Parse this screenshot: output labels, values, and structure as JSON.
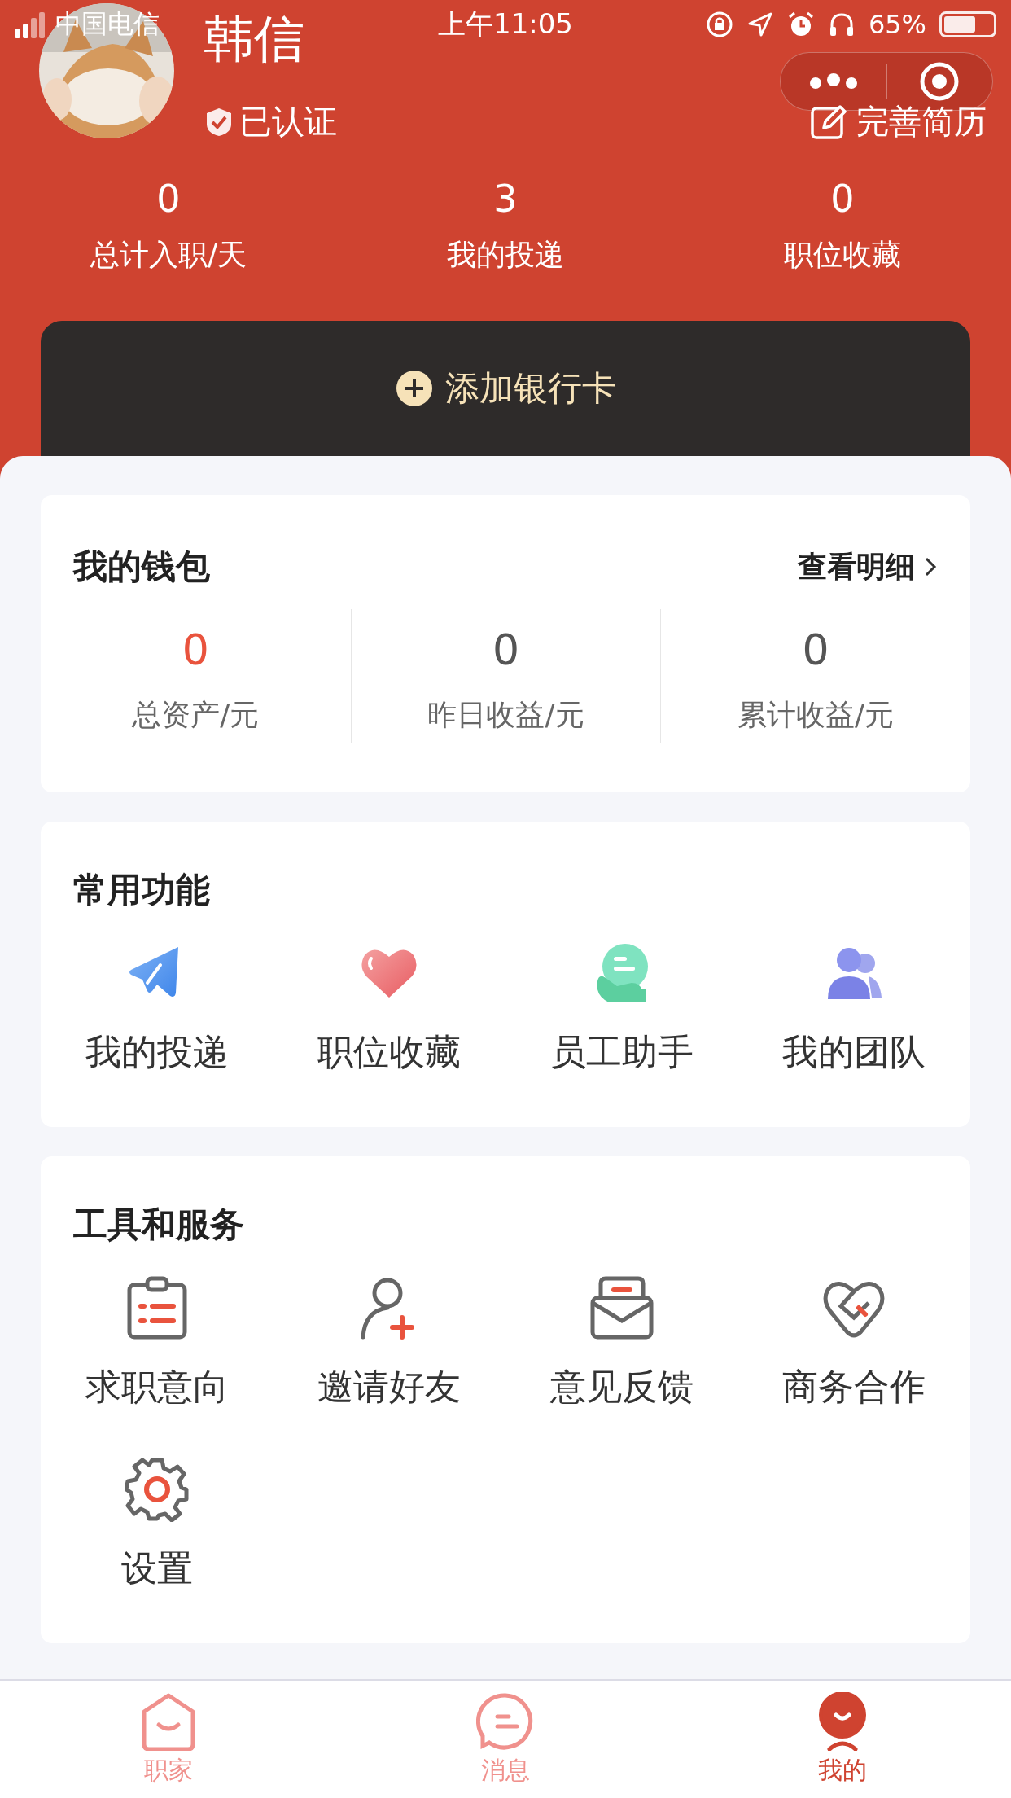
{
  "status_bar": {
    "carrier": "中国电信",
    "time": "上午11:05",
    "battery": "65%"
  },
  "profile": {
    "name": "韩信",
    "badge": "已认证",
    "edit_button": "完善简历"
  },
  "stats": [
    {
      "value": "0",
      "label": "总计入职/天"
    },
    {
      "value": "3",
      "label": "我的投递"
    },
    {
      "value": "0",
      "label": "职位收藏"
    }
  ],
  "bank_card_button": "添加银行卡",
  "wallet": {
    "title": "我的钱包",
    "detail_link": "查看明细",
    "items": [
      {
        "value": "0",
        "label": "总资产/元",
        "highlight": true
      },
      {
        "value": "0",
        "label": "昨日收益/元",
        "highlight": false
      },
      {
        "value": "0",
        "label": "累计收益/元",
        "highlight": false
      }
    ]
  },
  "common_functions": {
    "title": "常用功能",
    "items": [
      {
        "label": "我的投递",
        "kind": "send"
      },
      {
        "label": "职位收藏",
        "kind": "heart"
      },
      {
        "label": "员工助手",
        "kind": "assistant"
      },
      {
        "label": "我的团队",
        "kind": "team"
      }
    ]
  },
  "tools": {
    "title": "工具和服务",
    "items": [
      {
        "label": "求职意向",
        "kind": "clipboard"
      },
      {
        "label": "邀请好友",
        "kind": "invite"
      },
      {
        "label": "意见反馈",
        "kind": "mail"
      },
      {
        "label": "商务合作",
        "kind": "handshake"
      },
      {
        "label": "设置",
        "kind": "settings"
      }
    ]
  },
  "tab_bar": [
    {
      "label": "职家",
      "kind": "home",
      "selected": false
    },
    {
      "label": "消息",
      "kind": "message",
      "selected": false
    },
    {
      "label": "我的",
      "kind": "me",
      "selected": true
    }
  ]
}
